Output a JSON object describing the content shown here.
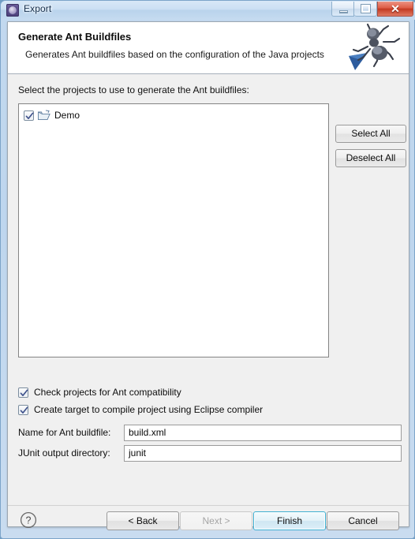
{
  "window": {
    "title": "Export",
    "app_icon": "export-icon",
    "controls": {
      "minimize": "minimize-icon",
      "maximize": "maximize-icon",
      "close": "✕"
    }
  },
  "header": {
    "title": "Generate Ant Buildfiles",
    "subtitle": "Generates Ant buildfiles based on the configuration of the Java projects",
    "banner_icon": "ant-logo-icon"
  },
  "main": {
    "prompt": "Select the projects to use to generate the Ant buildfiles:",
    "projects": [
      {
        "label": "Demo",
        "checked": true,
        "icon": "project-folder-icon"
      }
    ],
    "side_buttons": {
      "select_all": "Select All",
      "deselect_all": "Deselect All"
    },
    "options": [
      {
        "label": "Check projects for Ant compatibility",
        "checked": true
      },
      {
        "label": "Create target to compile project using Eclipse compiler",
        "checked": true
      }
    ],
    "fields": [
      {
        "label": "Name for Ant buildfile:",
        "value": "build.xml",
        "placeholder": ""
      },
      {
        "label": "JUnit output directory:",
        "value": "junit",
        "placeholder": ""
      }
    ]
  },
  "footer": {
    "help": "help-icon",
    "back": "< Back",
    "next": "Next >",
    "finish": "Finish",
    "cancel": "Cancel"
  },
  "colors": {
    "accent": "#3caed0",
    "title_text": "#17304d",
    "close_button": "#c33a22",
    "dialog_bg": "#f0f0f0",
    "banner_bg": "#ffffff"
  }
}
